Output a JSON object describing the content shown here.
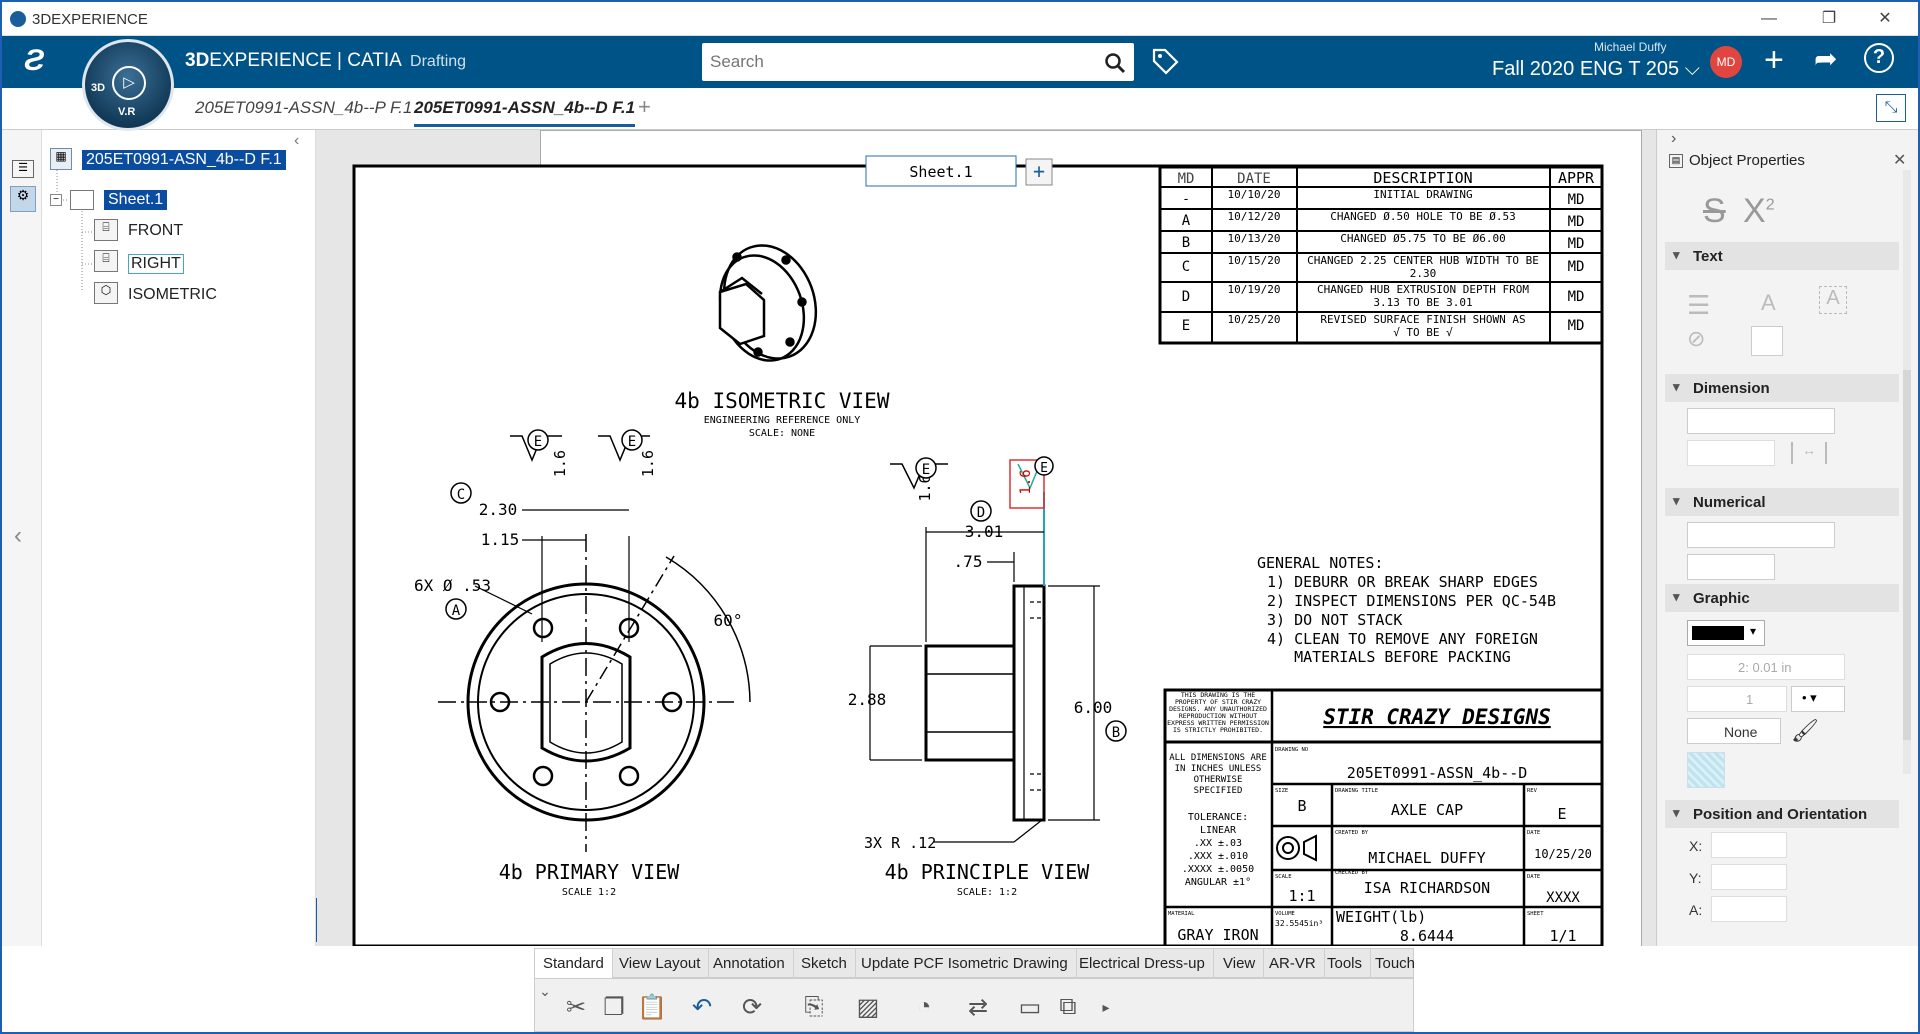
{
  "window": {
    "title": "3DEXPERIENCE"
  },
  "header": {
    "brand_bold": "3D",
    "brand_rest": "EXPERIENCE | CATIA",
    "app": "Drafting",
    "search_placeholder": "Search",
    "user_name": "Michael Duffy",
    "collab_space": "Fall 2020 ENG T 205",
    "avatar": "MD",
    "compass_label": "V.R",
    "compass_3d": "3D"
  },
  "doc_tabs": [
    {
      "label": "205ET0991-ASSN_4b--P F.1",
      "active": false
    },
    {
      "label": "205ET0991-ASSN_4b--D F.1",
      "active": true
    }
  ],
  "tree": {
    "root": "205ET0991-ASN_4b--D F.1",
    "sheet": "Sheet.1",
    "views": [
      "FRONT",
      "RIGHT",
      "ISOMETRIC"
    ]
  },
  "sheet_tab": "Sheet.1",
  "revision_table": {
    "headers": [
      "MD",
      "DATE",
      "DESCRIPTION",
      "APPR"
    ],
    "rows": [
      {
        "md": "-",
        "date": "10/10/20",
        "desc": "INITIAL DRAWING",
        "desc2": "",
        "appr": "MD"
      },
      {
        "md": "A",
        "date": "10/12/20",
        "desc": "CHANGED Ø.50 HOLE TO BE Ø.53",
        "desc2": "",
        "appr": "MD"
      },
      {
        "md": "B",
        "date": "10/13/20",
        "desc": "CHANGED Ø5.75 TO BE Ø6.00",
        "desc2": "",
        "appr": "MD"
      },
      {
        "md": "C",
        "date": "10/15/20",
        "desc": "CHANGED 2.25 CENTER HUB WIDTH TO BE",
        "desc2": "2.30",
        "appr": "MD"
      },
      {
        "md": "D",
        "date": "10/19/20",
        "desc": "CHANGED HUB EXTRUSION DEPTH FROM",
        "desc2": "3.13 TO BE 3.01",
        "appr": "MD"
      },
      {
        "md": "E",
        "date": "10/25/20",
        "desc": "REVISED SURFACE FINISH SHOWN AS",
        "desc2": "√ TO BE √",
        "appr": "MD"
      }
    ]
  },
  "views": {
    "iso_title": "4b ISOMETRIC VIEW",
    "iso_sub1": "ENGINEERING REFERENCE ONLY",
    "iso_sub2": "SCALE: NONE",
    "primary_title": "4b PRIMARY VIEW",
    "primary_scale": "SCALE 1:2",
    "principle_title": "4b PRINCIPLE VIEW",
    "principle_scale": "SCALE: 1:2"
  },
  "dims": {
    "d230": "2.30",
    "d115": "1.15",
    "hole": "6X Ø .53",
    "angle": "60°",
    "d301": "3.01",
    "d75": ".75",
    "d288": "2.88",
    "d600": "6.00",
    "r12": "3X R .12",
    "finish": "1.6",
    "marker_A": "A",
    "marker_B": "B",
    "marker_C": "C",
    "marker_D": "D",
    "marker_E": "E"
  },
  "notes": {
    "title": "GENERAL NOTES:",
    "items": [
      "1) DEBURR OR BREAK SHARP EDGES",
      "2) INSPECT DIMENSIONS PER QC-54B",
      "3) DO NOT STACK",
      "4) CLEAN TO REMOVE ANY FOREIGN",
      "   MATERIALS BEFORE PACKING"
    ]
  },
  "title_block": {
    "prop1": "THIS DRAWING IS THE",
    "prop2": "PROPERTY OF STIR CRAZY",
    "prop3": "DESIGNS. ANY UNAUTHORIZED",
    "prop4": "REPRODUCTION WITHOUT",
    "prop5": "EXPRESS WRITTEN PERMISSION",
    "prop6": "IS STRICTLY PROHIBITED.",
    "company": "STIR CRAZY DESIGNS",
    "dims1": "ALL DIMENSIONS ARE",
    "dims2": "IN INCHES UNLESS",
    "dims3": "OTHERWISE",
    "dims4": "SPECIFIED",
    "tol_title": "TOLERANCE:",
    "tol_lin": "LINEAR",
    "tol1": ".XX ±.03",
    "tol2": ".XXX ±.010",
    "tol3": ".XXXX ±.0050",
    "tol4": "ANGULAR ±1°",
    "drawing_no_lbl": "DRAWING NO",
    "drawing_no": "205ET0991-ASSN_4b--D",
    "size_lbl": "SIZE",
    "size": "B",
    "title_lbl": "DRAWING TITLE",
    "title": "AXLE CAP",
    "rev_lbl": "REV",
    "rev": "E",
    "created_lbl": "CREATED BY",
    "created": "MICHAEL DUFFY",
    "date_lbl": "DATE",
    "date": "10/25/20",
    "checked_lbl": "CHECKED BY",
    "checked": "ISA RICHARDSON",
    "date2_lbl": "DATE",
    "date2": "XXXX",
    "scale_lbl": "SCALE",
    "scale": "1:1",
    "material_lbl": "MATERIAL",
    "material": "GRAY IRON",
    "volume_lbl": "VOLUME",
    "volume": "32.5545in³",
    "weight_lbl": "WEIGHT(lb)",
    "weight": "8.6444",
    "sheet_lbl": "SHEET",
    "sheet": "1/1"
  },
  "right_panel": {
    "title": "Object Properties",
    "sections": [
      "Text",
      "Dimension",
      "Numerical",
      "Graphic",
      "Position and Orientation"
    ],
    "thickness": "2: 0.01 in",
    "linetype": "1",
    "none": "None",
    "x": "X:",
    "y": "Y:",
    "a": "A:"
  },
  "tool_tabs": [
    "Standard",
    "View Layout",
    "Annotation",
    "Sketch",
    "Update PCF Isometric Drawing",
    "Electrical Dress-up",
    "View",
    "AR-VR",
    "Tools",
    "Touch"
  ]
}
